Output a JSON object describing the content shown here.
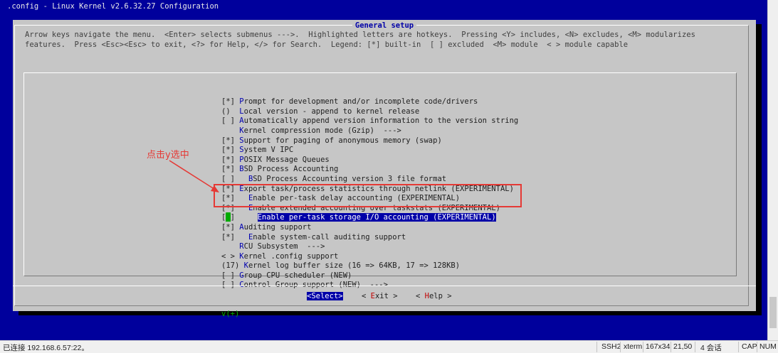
{
  "window": {
    "title": ".config - Linux Kernel v2.6.32.27 Configuration"
  },
  "dialog": {
    "title": "General setup",
    "help_line1": "Arrow keys navigate the menu.  <Enter> selects submenus --->.  Highlighted letters are hotkeys.  Pressing <Y> includes, <N> excludes, <M> modularizes",
    "help_line2": "features.  Press <Esc><Esc> to exit, <?> for Help, </> for Search.  Legend: [*] built-in  [ ] excluded  <M> module  < > module capable"
  },
  "menu": {
    "items": [
      {
        "prefix": "[*] ",
        "hot": "P",
        "rest": "rompt for development and/or incomplete code/drivers"
      },
      {
        "prefix": "()  ",
        "hot": "L",
        "rest": "ocal version - append to kernel release"
      },
      {
        "prefix": "[ ] ",
        "hot": "A",
        "rest": "utomatically append version information to the version string"
      },
      {
        "prefix": "    ",
        "hot": "K",
        "rest": "ernel compression mode (Gzip)  --->"
      },
      {
        "prefix": "[*] ",
        "hot": "S",
        "rest": "upport for paging of anonymous memory (swap)"
      },
      {
        "prefix": "[*] ",
        "hot": "S",
        "rest": "ystem V IPC"
      },
      {
        "prefix": "[*] ",
        "hot": "P",
        "rest": "OSIX Message Queues"
      },
      {
        "prefix": "[*] ",
        "hot": "B",
        "rest": "SD Process Accounting"
      },
      {
        "prefix": "[ ]   ",
        "hot": "B",
        "rest": "SD Process Accounting version 3 file format"
      },
      {
        "prefix": "[*] ",
        "hot": "E",
        "rest": "xport task/process statistics through netlink (EXPERIMENTAL)"
      },
      {
        "prefix": "[*]   ",
        "hot": "E",
        "rest": "nable per-task delay accounting (EXPERIMENTAL)"
      },
      {
        "prefix": "[*]   ",
        "hot": "E",
        "rest": "nable extended accounting over taskstats (EXPERIMENTAL)"
      },
      {
        "prefix": "[ ]     ",
        "hot": "E",
        "rest": "nable per-task storage I/O accounting (EXPERIMENTAL)",
        "selected": true
      },
      {
        "prefix": "[*] ",
        "hot": "A",
        "rest": "uditing support"
      },
      {
        "prefix": "[*]   ",
        "hot": "E",
        "rest": "nable system-call auditing support"
      },
      {
        "prefix": "    ",
        "hot": "R",
        "rest": "CU Subsystem  --->"
      },
      {
        "prefix": "< > ",
        "hot": "K",
        "rest": "ernel .config support"
      },
      {
        "prefix": "(17) ",
        "hot": "K",
        "rest": "ernel log buffer size (16 => 64KB, 17 => 128KB)"
      },
      {
        "prefix": "[ ] ",
        "hot": "G",
        "rest": "roup CPU scheduler (NEW)"
      },
      {
        "prefix": "[ ] ",
        "hot": "C",
        "rest": "ontrol Group support (NEW)  --->"
      }
    ],
    "more_indicator": "v(+)"
  },
  "buttons": {
    "select": {
      "left": "<",
      "hot": "S",
      "right": "elect>"
    },
    "exit": {
      "left": "< ",
      "hot": "E",
      "right": "xit >"
    },
    "help": {
      "left": "< ",
      "hot": "H",
      "right": "elp >"
    }
  },
  "annotation": {
    "text": "点击y选中",
    "color": "#e53935"
  },
  "statusbar": {
    "connection": "已连接 192.168.6.57:22。",
    "protocol": "SSH2",
    "terminal": "xterm",
    "size": "167x34",
    "cursor": "21,50",
    "sessions": "4 会话",
    "caps": "CAP",
    "num": "NUM"
  },
  "colors": {
    "background": "#00009c",
    "dialog": "#c6c6c6",
    "highlight": "#0000a8",
    "hotkey_button": "#c00000",
    "cursor": "#00aa00"
  }
}
